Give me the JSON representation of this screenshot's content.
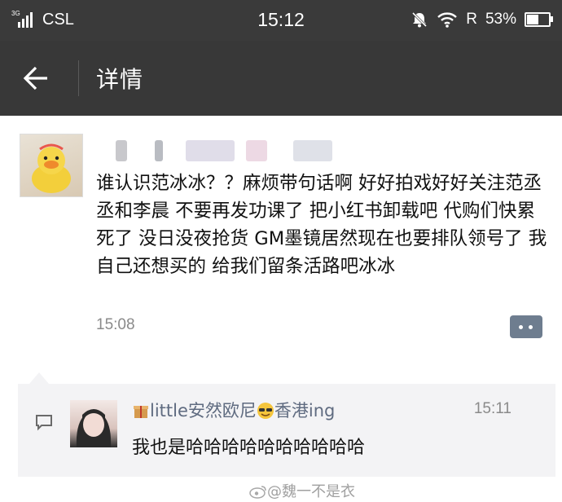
{
  "status_bar": {
    "network": "3G",
    "carrier": "CSL",
    "time": "15:12",
    "roaming": "R",
    "battery_percent": "53%",
    "battery_level": 0.53,
    "icons": [
      "signal-icon",
      "mute-icon",
      "wifi-icon",
      "battery-icon"
    ]
  },
  "header": {
    "back_icon": "back-arrow-icon",
    "title": "详情"
  },
  "post": {
    "text": "谁认识范冰冰？？麻烦带句话啊 好好拍戏好好关注范丞丞和李晨 不要再发功课了 把小红书卸载吧 代购们快累死了 没日没夜抢货 GM墨镜居然现在也要排队领号了 我自己还想买的 给我们留条活路吧冰冰",
    "time": "15:08",
    "comment_button_icon": "comment-more-icon"
  },
  "comment": {
    "name_part1": "little安然欧尼",
    "name_part2": "香港ing",
    "time": "15:11",
    "text": "我也是哈哈哈哈哈哈哈哈哈哈",
    "icon": "comment-icon"
  },
  "watermark": {
    "text": "@魏一不是衣",
    "icon": "weibo-icon"
  },
  "colors": {
    "header_bg": "#383838",
    "status_bg": "#3a3a3a",
    "nickname": "#5f6b80",
    "comment_bg": "#f3f3f5",
    "comment_button": "#6e7d8f"
  }
}
